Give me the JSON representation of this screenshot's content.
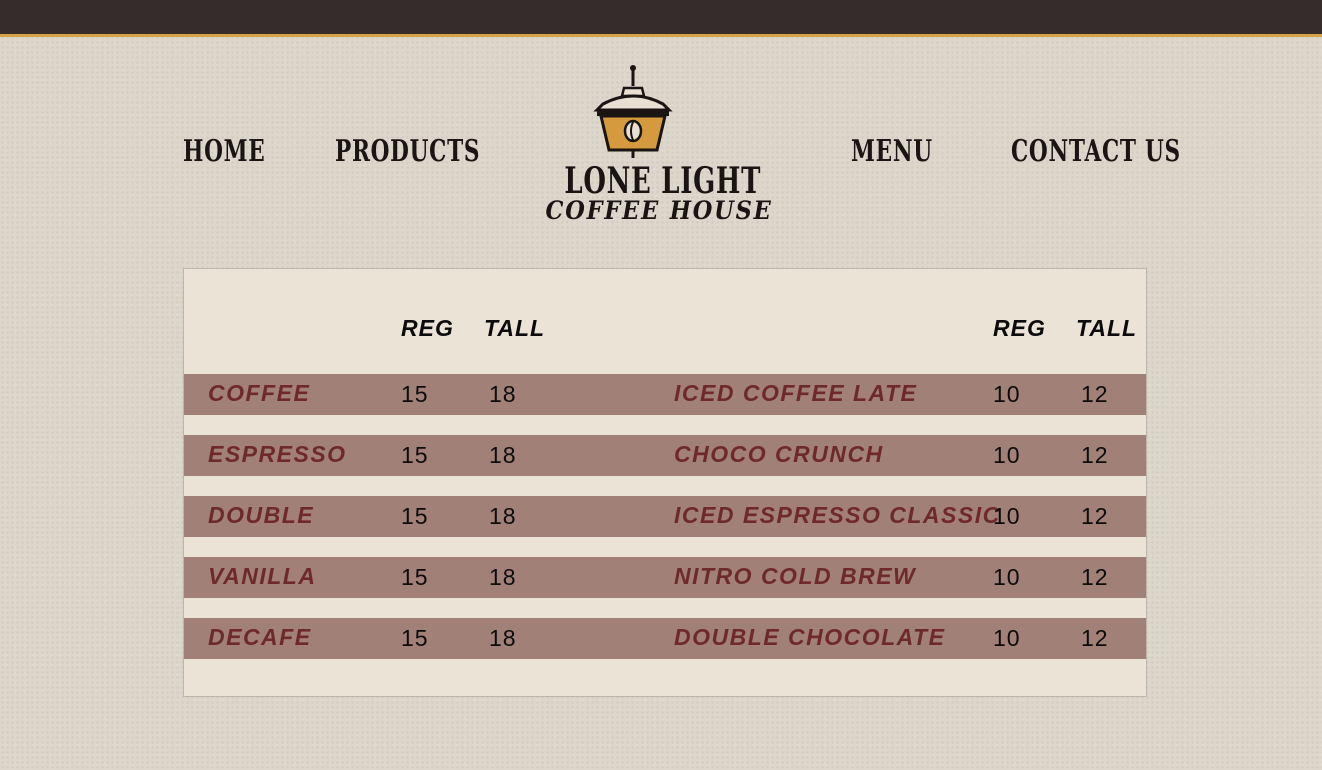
{
  "brand": {
    "name": "LONE LIGHT",
    "tagline": "COFFEE HOUSE",
    "icon": "lantern-coffee-bean-icon",
    "colors": {
      "bar": "#352d2c",
      "accent": "#d3a24a",
      "row": "#a18077",
      "item_text": "#6e2a2a"
    }
  },
  "nav": {
    "home": "HOME",
    "products": "PRODUCTS",
    "menu": "MENU",
    "contact": "CONTACT US"
  },
  "menu": {
    "left_headers": {
      "reg": "REG",
      "tall": "TALL"
    },
    "right_headers": {
      "reg": "REG",
      "tall": "TALL"
    },
    "rows": [
      {
        "left": {
          "name": "COFFEE",
          "reg": "15",
          "tall": "18"
        },
        "right": {
          "name": "ICED COFFEE LATE",
          "reg": "10",
          "tall": "12"
        }
      },
      {
        "left": {
          "name": "ESPRESSO",
          "reg": "15",
          "tall": "18"
        },
        "right": {
          "name": "CHOCO CRUNCH",
          "reg": "10",
          "tall": "12"
        }
      },
      {
        "left": {
          "name": "DOUBLE",
          "reg": "15",
          "tall": "18"
        },
        "right": {
          "name": "ICED ESPRESSO CLASSIC",
          "reg": "10",
          "tall": "12"
        }
      },
      {
        "left": {
          "name": "VANILLA",
          "reg": "15",
          "tall": "18"
        },
        "right": {
          "name": "NITRO COLD BREW",
          "reg": "10",
          "tall": "12"
        }
      },
      {
        "left": {
          "name": "DECAFE",
          "reg": "15",
          "tall": "18"
        },
        "right": {
          "name": "DOUBLE CHOCOLATE",
          "reg": "10",
          "tall": "12"
        }
      }
    ]
  }
}
